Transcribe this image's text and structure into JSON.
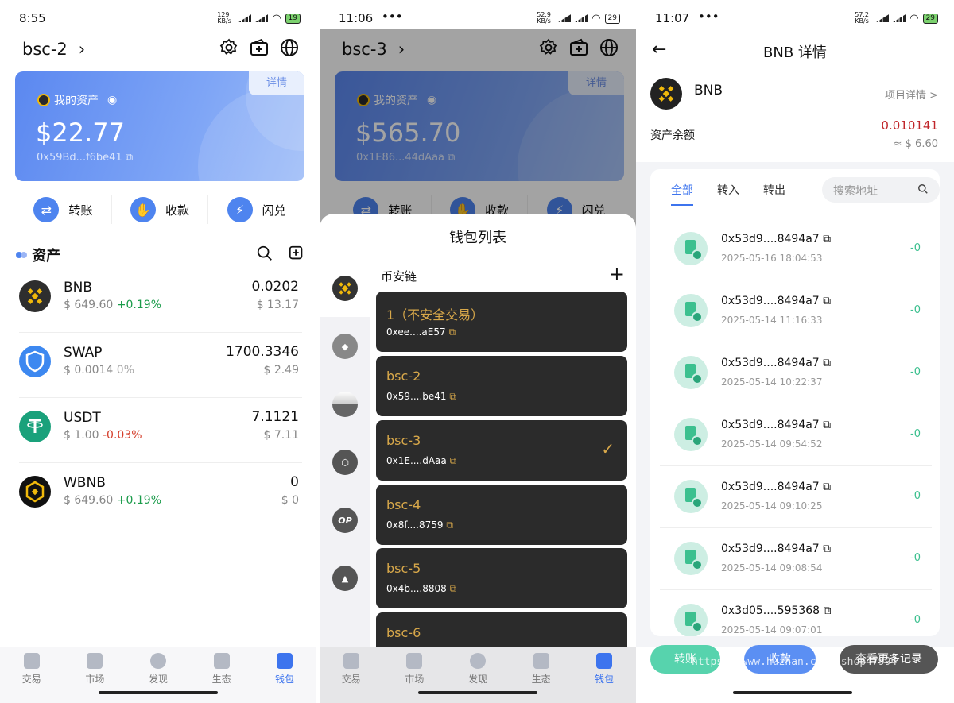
{
  "screen1": {
    "status": {
      "time": "8:55",
      "net": "129 KB/s",
      "battery": "19"
    },
    "wallet_name": "bsc-2",
    "card": {
      "label": "我的资产",
      "detail": "详情",
      "amount": "$22.77",
      "address": "0x59Bd...f6be41"
    },
    "actions": [
      {
        "label": "转账"
      },
      {
        "label": "收款"
      },
      {
        "label": "闪兑"
      }
    ],
    "section_title": "资产",
    "assets": [
      {
        "symbol": "BNB",
        "price": "$ 649.60",
        "change": "+0.19%",
        "balance": "0.0202",
        "usd": "$ 13.17",
        "trend": "up"
      },
      {
        "symbol": "SWAP",
        "price": "$ 0.0014",
        "change": "0%",
        "balance": "1700.3346",
        "usd": "$ 2.49",
        "trend": "flat"
      },
      {
        "symbol": "USDT",
        "price": "$ 1.00",
        "change": "-0.03%",
        "balance": "7.1121",
        "usd": "$ 7.11",
        "trend": "down"
      },
      {
        "symbol": "WBNB",
        "price": "$ 649.60",
        "change": "+0.19%",
        "balance": "0",
        "usd": "$ 0",
        "trend": "up"
      }
    ],
    "tabs": [
      "交易",
      "市场",
      "发现",
      "生态",
      "钱包"
    ],
    "active_tab": "钱包"
  },
  "screen2": {
    "status": {
      "time": "11:06",
      "net": "52.9 KB/s",
      "battery": "29"
    },
    "wallet_name": "bsc-3",
    "card": {
      "label": "我的资产",
      "detail": "详情",
      "amount": "$565.70",
      "address": "0x1E86...44dAaa"
    },
    "actions": [
      {
        "label": "转账"
      },
      {
        "label": "收款"
      },
      {
        "label": "闪兑"
      }
    ],
    "sheet_title": "钱包列表",
    "chain_name": "币安链",
    "chains": [
      "BNB",
      "ETH",
      "",
      "ARB",
      "OP",
      "AVAX"
    ],
    "wallets": [
      {
        "name": "1（不安全交易）",
        "address": "0xee....aE57",
        "selected": false
      },
      {
        "name": "bsc-2",
        "address": "0x59....be41",
        "selected": false
      },
      {
        "name": "bsc-3",
        "address": "0x1E....dAaa",
        "selected": true
      },
      {
        "name": "bsc-4",
        "address": "0x8f....8759",
        "selected": false
      },
      {
        "name": "bsc-5",
        "address": "0x4b....8808",
        "selected": false
      },
      {
        "name": "bsc-6",
        "address": "",
        "selected": false
      }
    ],
    "tabs": [
      "交易",
      "市场",
      "发现",
      "生态",
      "钱包"
    ]
  },
  "screen3": {
    "status": {
      "time": "11:07",
      "net": "57.2 KB/s",
      "battery": "29"
    },
    "title": "BNB 详情",
    "coin": {
      "symbol": "BNB",
      "project_link": "项目详情 >",
      "balance_label": "资产余额",
      "balance": "0.010141",
      "usd": "≈ $ 6.60"
    },
    "filter_tabs": [
      "全部",
      "转入",
      "转出"
    ],
    "search_placeholder": "搜索地址",
    "transactions": [
      {
        "address": "0x53d9....8494a7",
        "time": "2025-05-16 18:04:53",
        "amount": "-0"
      },
      {
        "address": "0x53d9....8494a7",
        "time": "2025-05-14 11:16:33",
        "amount": "-0"
      },
      {
        "address": "0x53d9....8494a7",
        "time": "2025-05-14 10:22:37",
        "amount": "-0"
      },
      {
        "address": "0x53d9....8494a7",
        "time": "2025-05-14 09:54:52",
        "amount": "-0"
      },
      {
        "address": "0x53d9....8494a7",
        "time": "2025-05-14 09:10:25",
        "amount": "-0"
      },
      {
        "address": "0x53d9....8494a7",
        "time": "2025-05-14 09:08:54",
        "amount": "-0"
      },
      {
        "address": "0x3d05....595368",
        "time": "2025-05-14 09:07:01",
        "amount": "-0"
      }
    ],
    "buttons": {
      "transfer": "转账",
      "receive": "收款",
      "more": "查看更多记录"
    },
    "watermark": "https://www.huzhan.com/ishop47994"
  },
  "colors": {
    "accent": "#3d74ee",
    "up": "#1a9b4a",
    "down": "#d43d2a",
    "wallet_gold": "#d8a84a"
  }
}
